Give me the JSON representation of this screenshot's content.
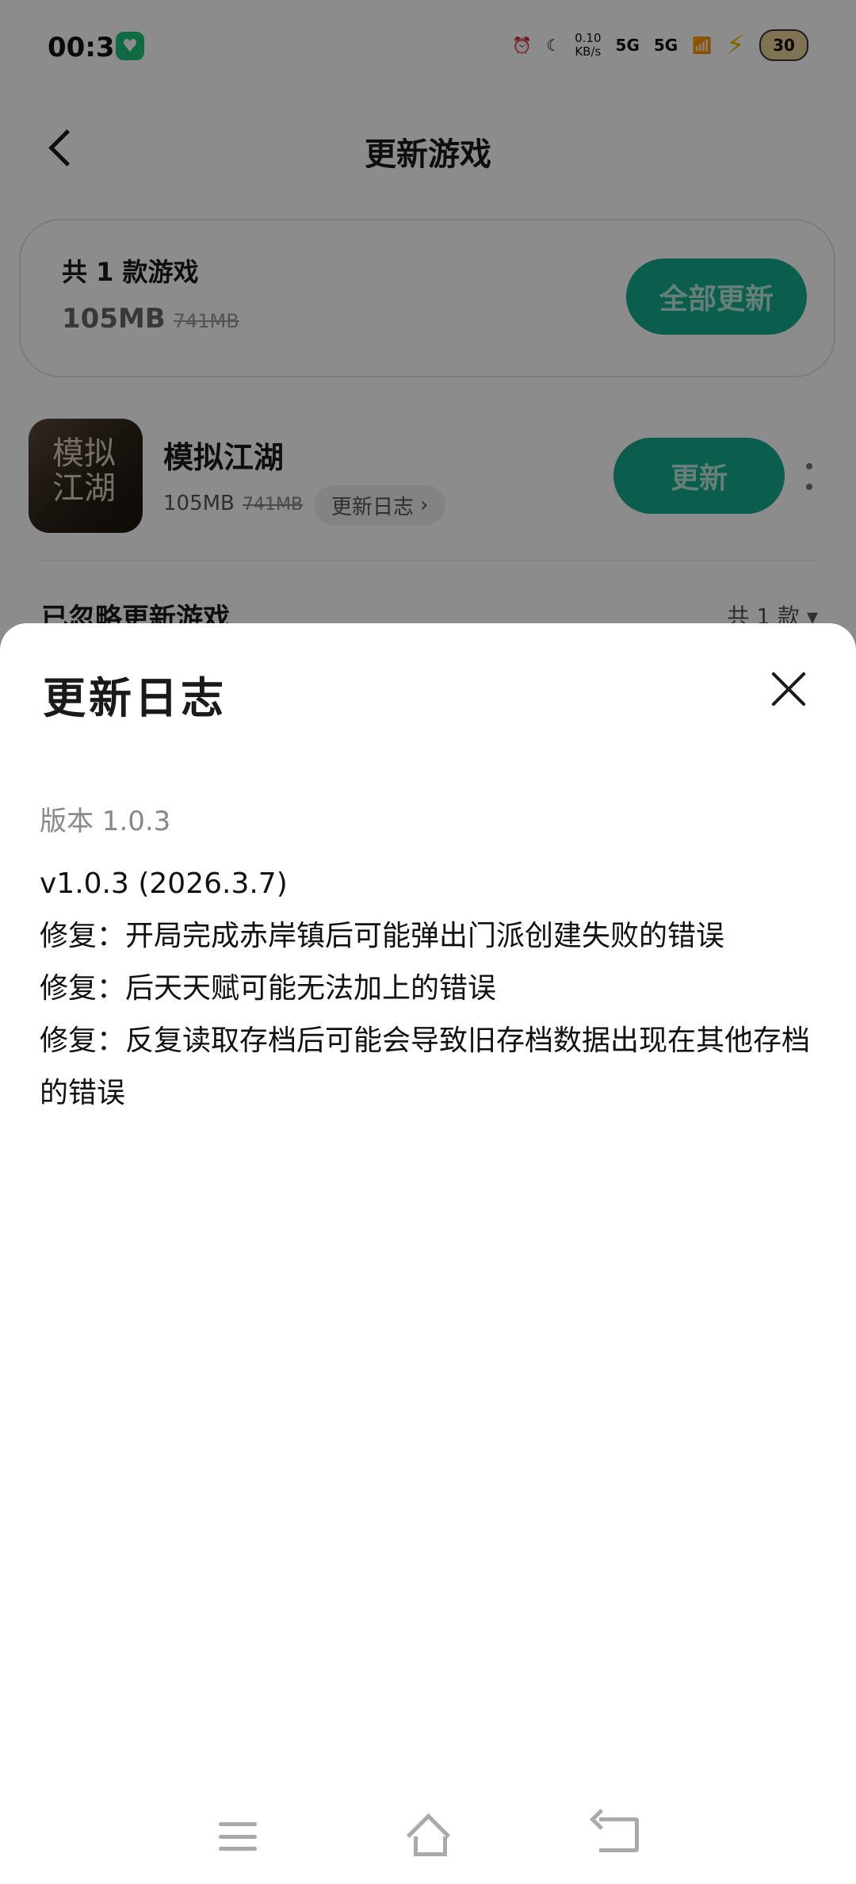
{
  "status_bar": {
    "time": "00:35",
    "speed_value": "0.10",
    "speed_unit": "KB/s",
    "signal_1": "5G",
    "signal_2": "5G",
    "battery": "30",
    "icons": [
      "alarm-icon",
      "do-not-disturb-moon-icon",
      "signal-5g-icon",
      "signal-5g-icon",
      "wifi-icon",
      "charging-bolt-icon",
      "battery-icon"
    ]
  },
  "header": {
    "title": "更新游戏"
  },
  "summary": {
    "count_text": "共 1 款游戏",
    "size": "105MB",
    "original_size": "741MB",
    "update_all_label": "全部更新"
  },
  "games": [
    {
      "name": "模拟江湖",
      "icon_text": "模拟江湖",
      "size": "105MB",
      "original_size": "741MB",
      "changelog_label": "更新日志",
      "update_label": "更新"
    }
  ],
  "ignored": {
    "title": "已忽略更新游戏",
    "count": "共 1 款"
  },
  "sheet": {
    "title": "更新日志",
    "version_label": "版本 1.0.3",
    "log_lines": [
      "v1.0.3 (2026.3.7)",
      "修复：开局完成赤岸镇后可能弹出门派创建失败的错误",
      "修复：后天天赋可能无法加上的错误",
      "修复：反复读取存档后可能会导致旧存档数据出现在其他存档的错误"
    ]
  },
  "colors": {
    "accent": "#15a98e",
    "scrim": "rgba(0,0,0,0.45)"
  }
}
